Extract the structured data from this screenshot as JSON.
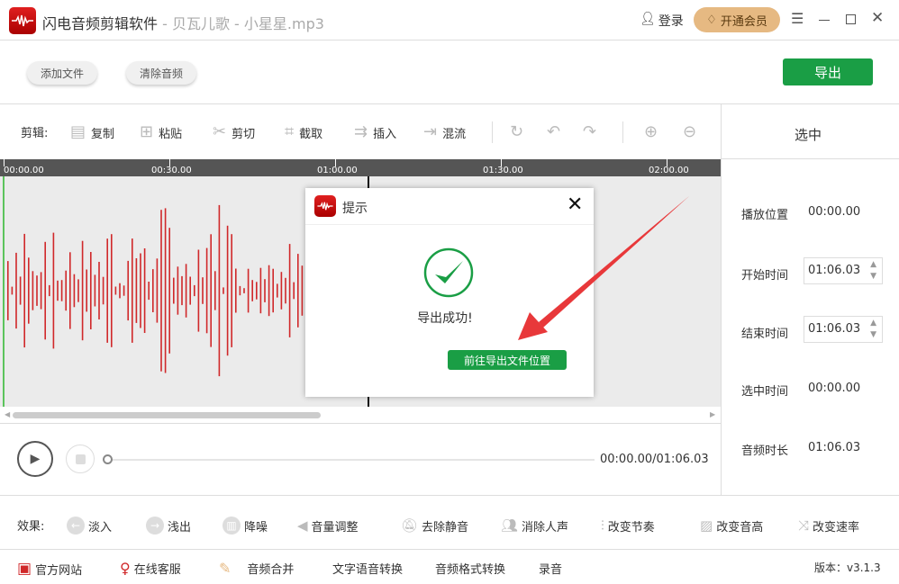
{
  "title": {
    "app": "闪电音频剪辑软件",
    "file": " - 贝瓦儿歌 - 小星星.mp3",
    "login": "登录",
    "vip": "开通会员"
  },
  "toolbar": {
    "add_file": "添加文件",
    "clear_audio": "清除音频",
    "export": "导出"
  },
  "edit": {
    "label": "剪辑:",
    "copy": "复制",
    "paste": "粘贴",
    "cut": "剪切",
    "crop": "截取",
    "insert": "插入",
    "mix": "混流"
  },
  "ruler": [
    "00:00.00",
    "00:30.00",
    "01:00.00",
    "01:30.00",
    "02:00.00"
  ],
  "player": {
    "time": "00:00.00/01:06.03",
    "progress": 0
  },
  "panel": {
    "header": "选中",
    "play_pos_label": "播放位置",
    "play_pos": "00:00.00",
    "start_label": "开始时间",
    "start": "01:06.03",
    "end_label": "结束时间",
    "end": "01:06.03",
    "sel_label": "选中时间",
    "sel": "00:00.00",
    "dur_label": "音频时长",
    "dur": "01:06.03"
  },
  "effects": {
    "label": "效果:",
    "items": [
      "淡入",
      "浅出",
      "降噪",
      "音量调整",
      "去除静音",
      "消除人声",
      "改变节奏",
      "改变音高",
      "改变速率"
    ]
  },
  "footer": {
    "site": "官方网站",
    "service": "在线客服",
    "merge": "音频合并",
    "tts": "文字语音转换",
    "convert": "音频格式转换",
    "record": "录音",
    "version": "版本：v3.1.3"
  },
  "dialog": {
    "title": "提示",
    "message": "导出成功!",
    "button": "前往导出文件位置"
  },
  "colors": {
    "green": "#1a9e45",
    "red": "#d0282a",
    "ruler": "#555555"
  }
}
